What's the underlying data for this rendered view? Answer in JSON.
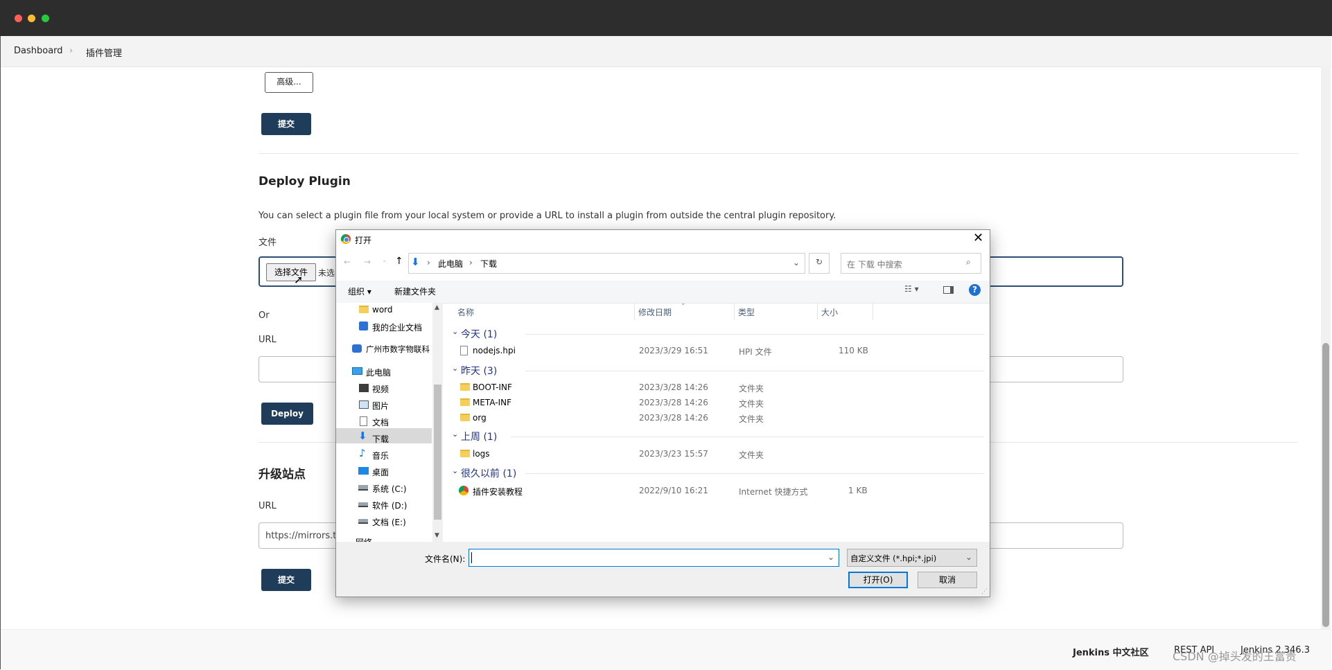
{
  "breadcrumb": {
    "home": "Dashboard",
    "current": "插件管理"
  },
  "top": {
    "advanced_label": "高级...",
    "submit_label": "提交"
  },
  "deploy": {
    "title": "Deploy Plugin",
    "description": "You can select a plugin file from your local system or provide a URL to install a plugin from outside the central plugin repository.",
    "file_label": "文件",
    "choose_file_label": "选择文件",
    "no_file_label": "未选",
    "or_label": "Or",
    "url_label": "URL",
    "deploy_label": "Deploy"
  },
  "update_site": {
    "title": "升级站点",
    "url_label": "URL",
    "url_value": "https://mirrors.tu",
    "submit_label": "提交"
  },
  "footer": {
    "community": "Jenkins 中文社区",
    "rest_api": "REST API",
    "version": "Jenkins 2.346.3",
    "watermark": "CSDN @掉头发的王富贵"
  },
  "dialog": {
    "title": "打开",
    "path": [
      "此电脑",
      "下载"
    ],
    "search_placeholder": "在 下载 中搜索",
    "organize_label": "组织 ▾",
    "new_folder_label": "新建文件夹",
    "nav": [
      {
        "label": "word",
        "icon": "folder-icon"
      },
      {
        "label": "我的企业文档",
        "icon": "contact-card-icon"
      },
      {
        "label": "广州市数字物联科",
        "icon": "cloud-drive-icon"
      },
      {
        "label": "此电脑",
        "icon": "computer-icon"
      },
      {
        "label": "视频",
        "icon": "video-icon"
      },
      {
        "label": "图片",
        "icon": "pictures-icon"
      },
      {
        "label": "文档",
        "icon": "documents-icon"
      },
      {
        "label": "下载",
        "icon": "download-icon"
      },
      {
        "label": "音乐",
        "icon": "music-icon"
      },
      {
        "label": "桌面",
        "icon": "desktop-icon"
      },
      {
        "label": "系统 (C:)",
        "icon": "drive-icon"
      },
      {
        "label": "软件 (D:)",
        "icon": "drive-icon"
      },
      {
        "label": "文档 (E:)",
        "icon": "drive-icon"
      },
      {
        "label": "网络",
        "icon": "network-icon"
      }
    ],
    "columns": {
      "name": "名称",
      "modified": "修改日期",
      "type": "类型",
      "size": "大小"
    },
    "groups": [
      {
        "label": "今天 (1)",
        "items": [
          {
            "name": "nodejs.hpi",
            "date": "2023/3/29 16:51",
            "type": "HPI 文件",
            "size": "110 KB",
            "icon": "file-icon"
          }
        ]
      },
      {
        "label": "昨天 (3)",
        "items": [
          {
            "name": "BOOT-INF",
            "date": "2023/3/28 14:26",
            "type": "文件夹",
            "size": "",
            "icon": "folder-icon"
          },
          {
            "name": "META-INF",
            "date": "2023/3/28 14:26",
            "type": "文件夹",
            "size": "",
            "icon": "folder-icon"
          },
          {
            "name": "org",
            "date": "2023/3/28 14:26",
            "type": "文件夹",
            "size": "",
            "icon": "folder-icon"
          }
        ]
      },
      {
        "label": "上周 (1)",
        "items": [
          {
            "name": "logs",
            "date": "2023/3/23 15:57",
            "type": "文件夹",
            "size": "",
            "icon": "folder-icon"
          }
        ]
      },
      {
        "label": "很久以前 (1)",
        "items": [
          {
            "name": "插件安装教程",
            "date": "2022/9/10 16:21",
            "type": "Internet 快捷方式",
            "size": "1 KB",
            "icon": "chrome-shortcut-icon"
          }
        ]
      }
    ],
    "filename_label": "文件名(N):",
    "filename_value": "",
    "filter_label": "自定义文件 (*.hpi;*.jpi)",
    "open_label": "打开(O)",
    "cancel_label": "取消"
  },
  "colors": {
    "accent_dark": "#1f3d5a",
    "link_blue": "#1e3287",
    "folder": "#f5cf5b"
  }
}
